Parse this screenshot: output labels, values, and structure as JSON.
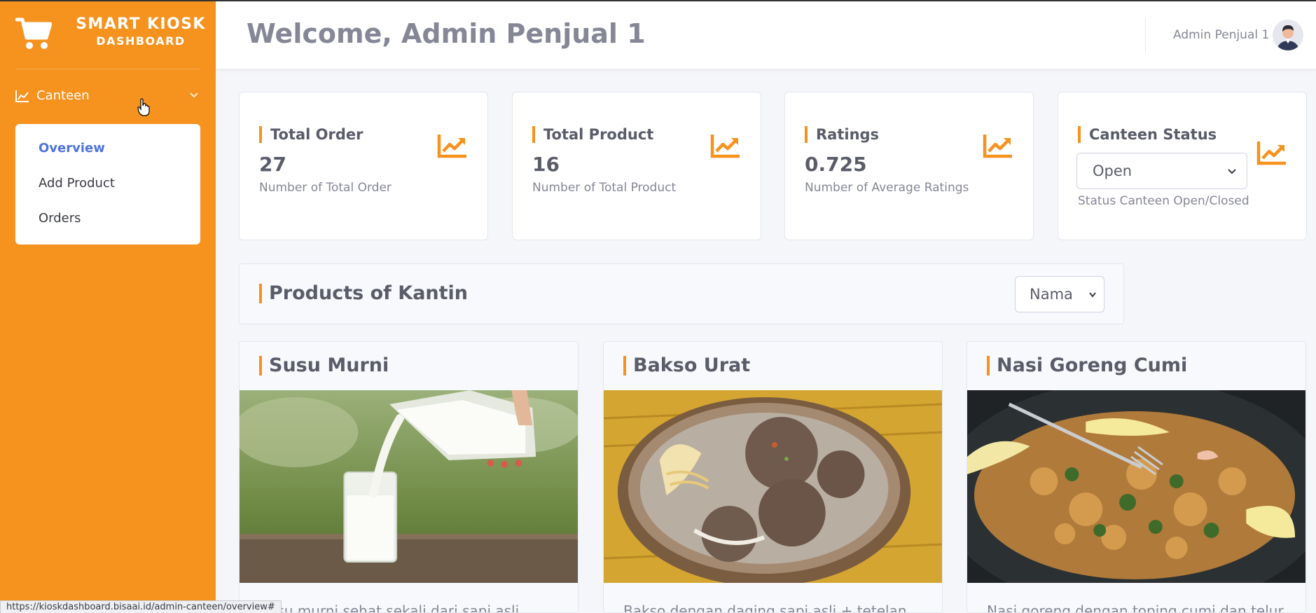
{
  "app": {
    "brand_line1": "SMART KIOSK",
    "brand_line2": "DASHBOARD",
    "accent_color": "#f6921e"
  },
  "sidebar": {
    "section_label": "Canteen",
    "section_icon": "chart-area-icon",
    "items": [
      {
        "label": "Overview",
        "active": true
      },
      {
        "label": "Add Product",
        "active": false
      },
      {
        "label": "Orders",
        "active": false
      }
    ]
  },
  "topbar": {
    "welcome": "Welcome, Admin Penjual 1",
    "user_name": "Admin Penjual 1"
  },
  "stats": [
    {
      "title": "Total Order",
      "value": "27",
      "desc": "Number of Total Order",
      "icon": "chart-line-icon"
    },
    {
      "title": "Total Product",
      "value": "16",
      "desc": "Number of Total Product",
      "icon": "chart-line-icon"
    },
    {
      "title": "Ratings",
      "value": "0.725",
      "desc": "Number of Average Ratings",
      "icon": "chart-line-icon"
    },
    {
      "title": "Canteen Status",
      "select_value": "Open",
      "desc": "Status Canteen Open/Closed",
      "icon": "chart-line-icon"
    }
  ],
  "products_section": {
    "title": "Products of Kantin",
    "sort_value": "Nama"
  },
  "products": [
    {
      "name": "Susu Murni",
      "desc": "Susu murni sehat sekali dari sapi asli",
      "image": "milk-pouring-photo"
    },
    {
      "name": "Bakso Urat",
      "desc": "Bakso dengan daging sapi asli + tetelan",
      "image": "meatball-soup-photo"
    },
    {
      "name": "Nasi Goreng Cumi",
      "desc": "Nasi goreng dengan toping cumi dan telur",
      "image": "squid-fried-rice-photo"
    }
  ],
  "status_bar": {
    "url": "https://kioskdashboard.bisaai.id/admin-canteen/overview#"
  }
}
